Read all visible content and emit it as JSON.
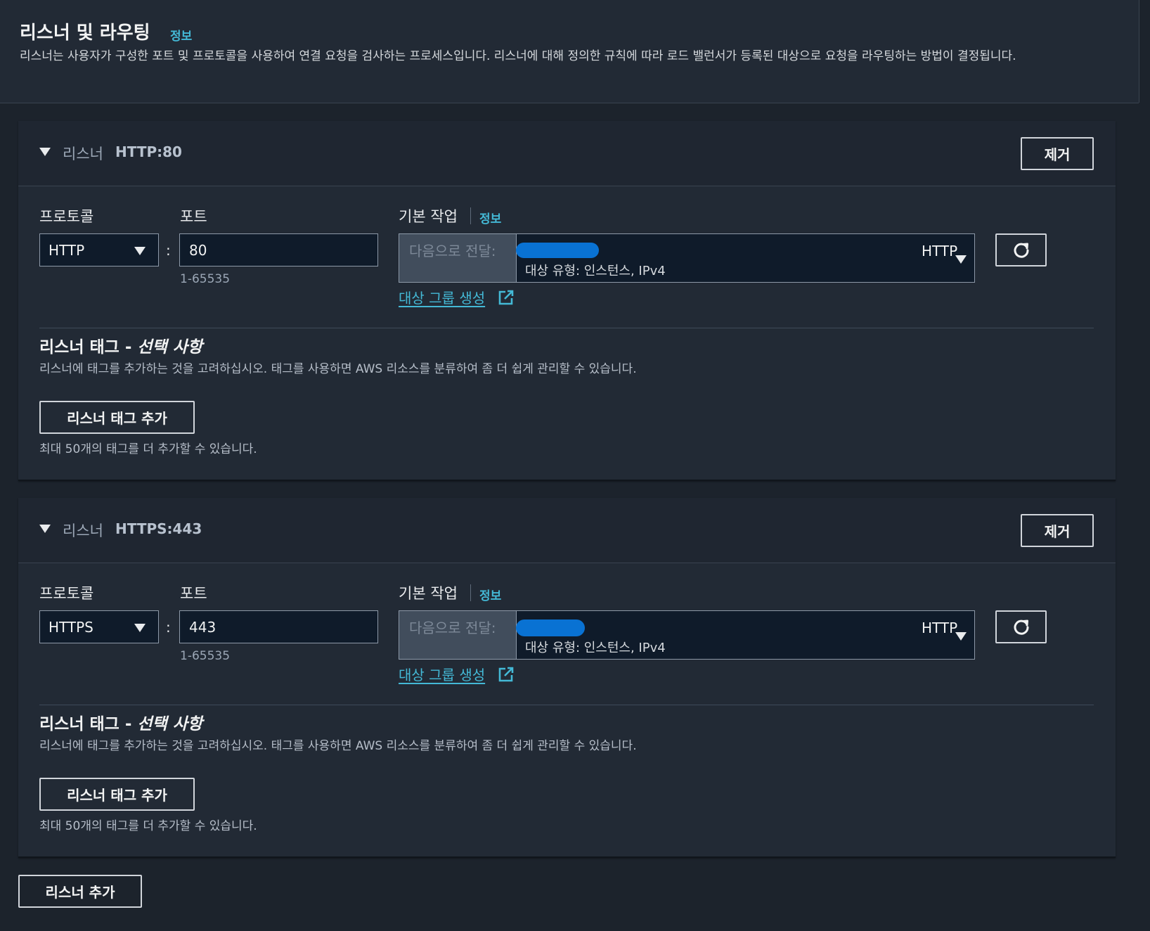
{
  "header": {
    "title": "리스너 및 라우팅",
    "info": "정보",
    "description": "리스너는 사용자가 구성한 포트 및 프로토콜을 사용하여 연결 요청을 검사하는 프로세스입니다. 리스너에 대해 정의한 규칙에 따라 로드 밸런서가 등록된 대상으로 요청을 라우팅하는 방법이 결정됩니다."
  },
  "listeners": [
    {
      "label": "리스너",
      "name": "HTTP:80",
      "remove": "제거",
      "protocol_label": "프로토콜",
      "protocol": "HTTP",
      "port_label": "포트",
      "port": "80",
      "port_hint": "1-65535",
      "action_label": "기본 작업",
      "action_info": "정보",
      "action_prefix": "다음으로 전달:",
      "target_type": "대상 유형: 인스턴스, IPv4",
      "target_protocol": "HTTP",
      "create_group": "대상 그룹 생성",
      "tags_title": "리스너 태그 - ",
      "tags_optional": "선택 사항",
      "tags_desc": "리스너에 태그를 추가하는 것을 고려하십시오. 태그를 사용하면 AWS 리소스를 분류하여 좀 더 쉽게 관리할 수 있습니다.",
      "add_tag": "리스너 태그 추가",
      "tag_limit": "최대 50개의 태그를 더 추가할 수 있습니다."
    },
    {
      "label": "리스너",
      "name": "HTTPS:443",
      "remove": "제거",
      "protocol_label": "프로토콜",
      "protocol": "HTTPS",
      "port_label": "포트",
      "port": "443",
      "port_hint": "1-65535",
      "action_label": "기본 작업",
      "action_info": "정보",
      "action_prefix": "다음으로 전달:",
      "target_type": "대상 유형: 인스턴스, IPv4",
      "target_protocol": "HTTP",
      "create_group": "대상 그룹 생성",
      "tags_title": "리스너 태그 - ",
      "tags_optional": "선택 사항",
      "tags_desc": "리스너에 태그를 추가하는 것을 고려하십시오. 태그를 사용하면 AWS 리소스를 분류하여 좀 더 쉽게 관리할 수 있습니다.",
      "add_tag": "리스너 태그 추가",
      "tag_limit": "최대 50개의 태그를 더 추가할 수 있습니다."
    }
  ],
  "add_listener": "리스너 추가",
  "icons": {
    "caret": "caret-down-icon",
    "dropdown": "triangle-down-icon",
    "refresh": "refresh-icon",
    "external": "external-link-icon"
  },
  "colors": {
    "background": "#1c232c",
    "panel": "#222a35",
    "link": "#44b9d6",
    "redaction": "#0972d3"
  }
}
